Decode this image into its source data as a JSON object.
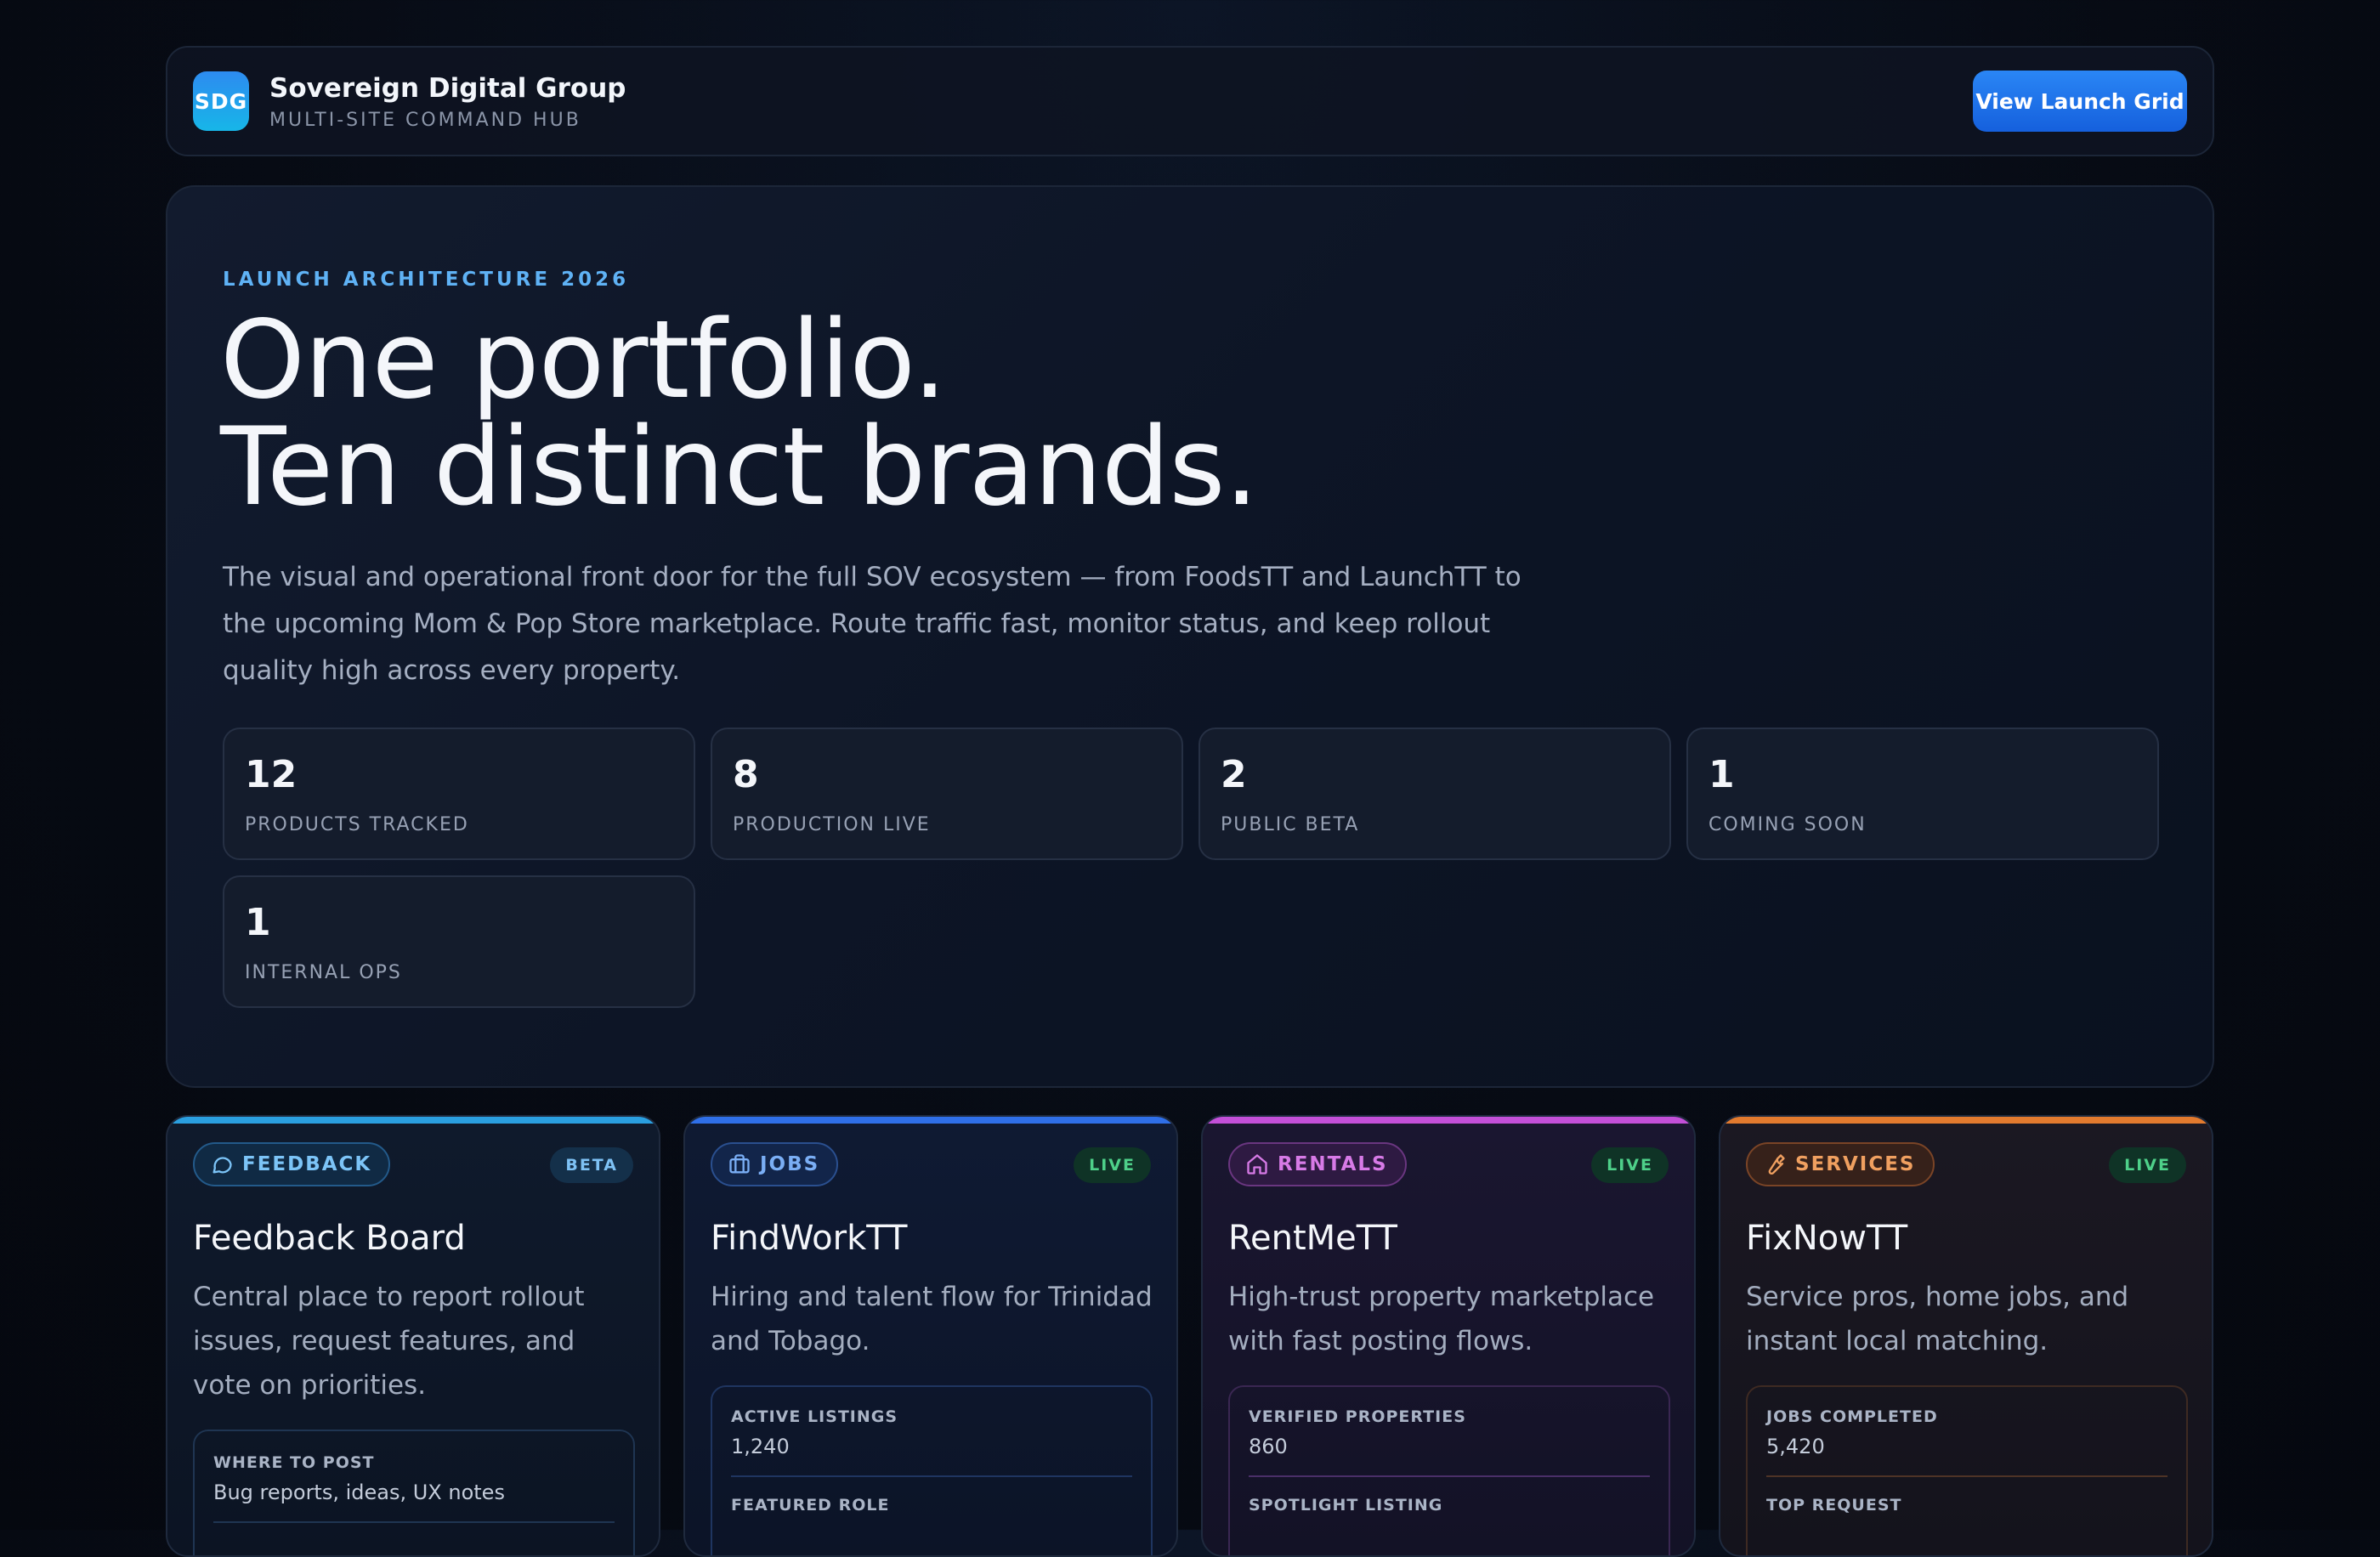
{
  "header": {
    "logo_text": "SDG",
    "brand_name": "Sovereign Digital Group",
    "brand_sub": "MULTI-SITE COMMAND HUB",
    "cta_label": "View Launch Grid"
  },
  "hero": {
    "eyebrow": "LAUNCH ARCHITECTURE 2026",
    "headline_line1": "One portfolio.",
    "headline_line2": "Ten distinct brands.",
    "lede": "The visual and operational front door for the full SOV ecosystem — from FoodsTT and LaunchTT to the upcoming Mom & Pop Store marketplace. Route traffic fast, monitor status, and keep rollout quality high across every property.",
    "stats": [
      {
        "value": "12",
        "label": "PRODUCTS TRACKED"
      },
      {
        "value": "8",
        "label": "PRODUCTION LIVE"
      },
      {
        "value": "2",
        "label": "PUBLIC BETA"
      },
      {
        "value": "1",
        "label": "COMING SOON"
      },
      {
        "value": "1",
        "label": "INTERNAL OPS"
      }
    ]
  },
  "cards": [
    {
      "tag": "FEEDBACK",
      "icon": "chat-bubble-icon",
      "status": "BETA",
      "title": "Feedback Board",
      "desc": "Central place to report rollout issues, request features, and vote on priorities.",
      "metric1_label": "WHERE TO POST",
      "metric1_value": "Bug reports, ideas, UX notes",
      "accent": "#2a9fe0"
    },
    {
      "tag": "JOBS",
      "icon": "briefcase-icon",
      "status": "LIVE",
      "title": "FindWorkTT",
      "desc": "Hiring and talent flow for Trinidad and Tobago.",
      "metric1_label": "ACTIVE LISTINGS",
      "metric1_value": "1,240",
      "metric2_label": "FEATURED ROLE",
      "accent": "#2f6fe8"
    },
    {
      "tag": "RENTALS",
      "icon": "house-icon",
      "status": "LIVE",
      "title": "RentMeTT",
      "desc": "High-trust property marketplace with fast posting flows.",
      "metric1_label": "VERIFIED PROPERTIES",
      "metric1_value": "860",
      "metric2_label": "SPOTLIGHT LISTING",
      "accent": "#c34fd8"
    },
    {
      "tag": "SERVICES",
      "icon": "wrench-icon",
      "status": "LIVE",
      "title": "FixNowTT",
      "desc": "Service pros, home jobs, and instant local matching.",
      "metric1_label": "JOBS COMPLETED",
      "metric1_value": "5,420",
      "metric2_label": "TOP REQUEST",
      "accent": "#e27a2e"
    }
  ]
}
